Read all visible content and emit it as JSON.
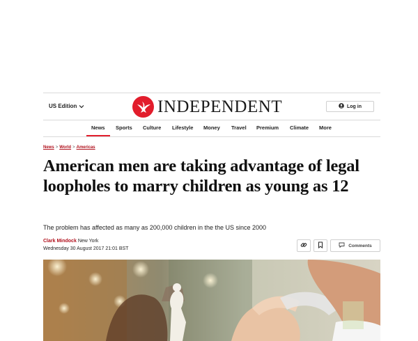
{
  "header": {
    "edition_label": "US Edition",
    "logo_text": "INDEPENDENT",
    "login_label": "Log in",
    "brand_color": "#e21d2c"
  },
  "nav": {
    "items": [
      "News",
      "Sports",
      "Culture",
      "Lifestyle",
      "Money",
      "Travel",
      "Premium",
      "Climate",
      "More"
    ],
    "active": "News"
  },
  "article": {
    "breadcrumb": [
      "News",
      "World",
      "Americas"
    ],
    "breadcrumb_separator": ">",
    "headline": "American men are taking advantage of legal loopholes to marry children as young as 12",
    "standfirst": "The problem has affected as many as 200,000 children in the the US since 2000",
    "author": "Clark Mindock",
    "location": "New York",
    "date": "Wednesday 30 August 2017 21:01 BST",
    "comments_label": "Comments"
  },
  "icons": {
    "edition_chevron": "chevron-down-icon",
    "login": "user-icon",
    "share": "link-icon",
    "bookmark": "bookmark-icon",
    "comments": "comment-icon",
    "logo": "eagle-icon"
  }
}
